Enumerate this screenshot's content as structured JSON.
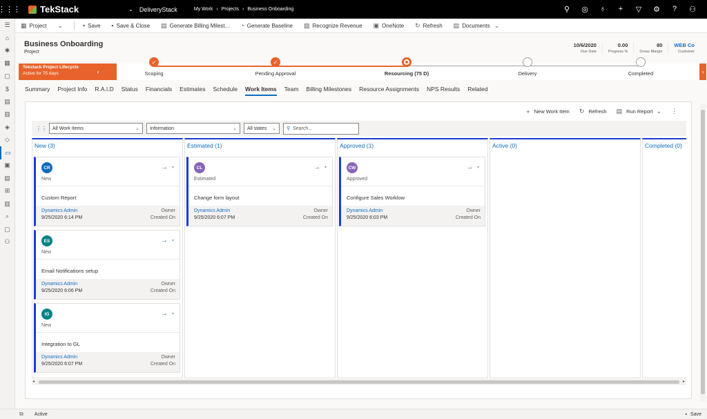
{
  "topbar": {
    "brand": "TekStack",
    "app": "DeliveryStack",
    "breadcrumbs": [
      "My Work",
      "Projects",
      "Business Onboarding"
    ],
    "icons": [
      "search-icon",
      "task-icon",
      "lightbulb-icon",
      "plus-icon",
      "filter-icon",
      "gear-icon",
      "help-icon",
      "user-icon"
    ]
  },
  "commands": [
    {
      "icon": "grid-icon",
      "label": "Project"
    },
    {
      "icon": "save-icon",
      "label": "Save"
    },
    {
      "icon": "save-close-icon",
      "label": "Save & Close"
    },
    {
      "icon": "document-icon",
      "label": "Generate Billing Milest..."
    },
    {
      "icon": "baseline-icon",
      "label": "Generate Baseline"
    },
    {
      "icon": "chart-icon",
      "label": "Recognize Revenue"
    },
    {
      "icon": "onenote-icon",
      "label": "OneNote"
    },
    {
      "icon": "refresh-icon",
      "label": "Refresh"
    },
    {
      "icon": "documents-icon",
      "label": "Documents"
    }
  ],
  "header": {
    "title": "Business Onboarding",
    "subtitle": "Project",
    "fields": [
      {
        "value": "10/6/2020",
        "label": "Due Date"
      },
      {
        "value": "0.00",
        "label": "Progress %"
      },
      {
        "value": "80",
        "label": "Gross Margin"
      },
      {
        "value": "WEB Co",
        "label": "Customer"
      }
    ]
  },
  "bpf": {
    "name": "Tekstack Project Lifecycle",
    "duration": "Active for 75 days",
    "stages": [
      {
        "label": "Scoping",
        "state": "done"
      },
      {
        "label": "Pending Approval",
        "state": "done"
      },
      {
        "label": "Resourcing  (75 D)",
        "state": "current"
      },
      {
        "label": "Delivery",
        "state": "todo"
      },
      {
        "label": "Completed",
        "state": "todo"
      }
    ]
  },
  "tabs": [
    "Summary",
    "Project Info",
    "R.A.I.D",
    "Status",
    "Financials",
    "Estimates",
    "Schedule",
    "Work Items",
    "Team",
    "Billing Milestones",
    "Resource Assignments",
    "NPS Results",
    "Related"
  ],
  "selected_tab": "Work Items",
  "toolbar": {
    "new_item": "New Work Item",
    "refresh": "Refresh",
    "run_report": "Run Report"
  },
  "filters": {
    "view": "All Work Items",
    "form": "Information",
    "states": "All states",
    "search_placeholder": "Search..."
  },
  "card_labels": {
    "owner": "Owner",
    "created_on": "Created On"
  },
  "columns": [
    {
      "title": "New (3)",
      "cards": [
        {
          "initials": "CR",
          "color": "#0f6cbd",
          "state": "New",
          "name": "Custom Report",
          "owner": "Dynamics Admin",
          "created": "9/25/2020 6:14 PM"
        },
        {
          "initials": "ES",
          "color": "#038387",
          "state": "New",
          "name": "Email Notifications setup",
          "owner": "Dynamics Admin",
          "created": "9/25/2020 6:06 PM"
        },
        {
          "initials": "IG",
          "color": "#038387",
          "state": "New",
          "name": "Integration to GL",
          "owner": "Dynamics Admin",
          "created": "9/25/2020 6:07 PM"
        }
      ]
    },
    {
      "title": "Estimated (1)",
      "cards": [
        {
          "initials": "CL",
          "color": "#8764b8",
          "state": "Estimated",
          "name": "Change form layout",
          "owner": "Dynamics Admin",
          "created": "9/25/2020 6:07 PM"
        }
      ]
    },
    {
      "title": "Approved (1)",
      "cards": [
        {
          "initials": "CW",
          "color": "#8764b8",
          "state": "Approved",
          "name": "Configure Sales Worklow",
          "owner": "Dynamics Admin",
          "created": "9/25/2020 6:03 PM"
        }
      ]
    },
    {
      "title": "Active (0)",
      "cards": []
    },
    {
      "title": "Completed (0)",
      "cards": []
    }
  ],
  "status": {
    "state": "Active",
    "save": "Save"
  }
}
